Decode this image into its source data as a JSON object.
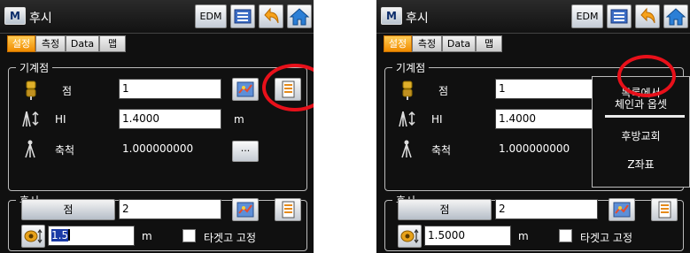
{
  "screens": [
    {
      "id": "left",
      "title": "후시",
      "logo": "M",
      "toolbar": {
        "edm_label": "EDM",
        "list_icon": "list-icon",
        "back_icon": "back-arrow-icon",
        "home_icon": "home-icon"
      },
      "tabs": [
        {
          "label": "설정",
          "active": true
        },
        {
          "label": "측정"
        },
        {
          "label": "Data"
        },
        {
          "label": "맵"
        }
      ],
      "group1": {
        "legend": "기계점",
        "point_label": "점",
        "point_value": "1",
        "hi_label": "HI",
        "hi_value": "1.4000",
        "hi_unit": "m",
        "scale_label": "축척",
        "scale_value": "1.000000000",
        "dots_label": "..."
      },
      "group2": {
        "legend": "후시",
        "point_button": "점",
        "point_value": "2",
        "height_value": "1.5",
        "height_unit": "m",
        "fixed_label": "타겟고 고정"
      }
    },
    {
      "id": "right",
      "title": "후시",
      "logo": "M",
      "toolbar": {
        "edm_label": "EDM",
        "list_icon": "list-icon",
        "back_icon": "back-arrow-icon",
        "home_icon": "home-icon"
      },
      "tabs": [
        {
          "label": "설정",
          "active": true
        },
        {
          "label": "측정"
        },
        {
          "label": "Data"
        },
        {
          "label": "맵"
        }
      ],
      "group1": {
        "legend": "기계점",
        "point_label": "점",
        "point_value": "1",
        "hi_label": "HI",
        "hi_value": "1.4000",
        "scale_label": "축척",
        "scale_value": "1.000000000"
      },
      "group2": {
        "legend": "후시",
        "point_button": "점",
        "point_value": "2",
        "height_value": "1.5000",
        "height_unit": "m",
        "fixed_label": "타겟고 고정"
      },
      "dropdown": {
        "items": [
          "목록에서",
          "체인과 옵셋",
          "후방교회",
          "Z좌표"
        ]
      }
    }
  ],
  "colors": {
    "active_tab": "#f08c00",
    "annotation_red": "#e8101a",
    "background": "#101010",
    "selection": "#1a3aa6"
  }
}
